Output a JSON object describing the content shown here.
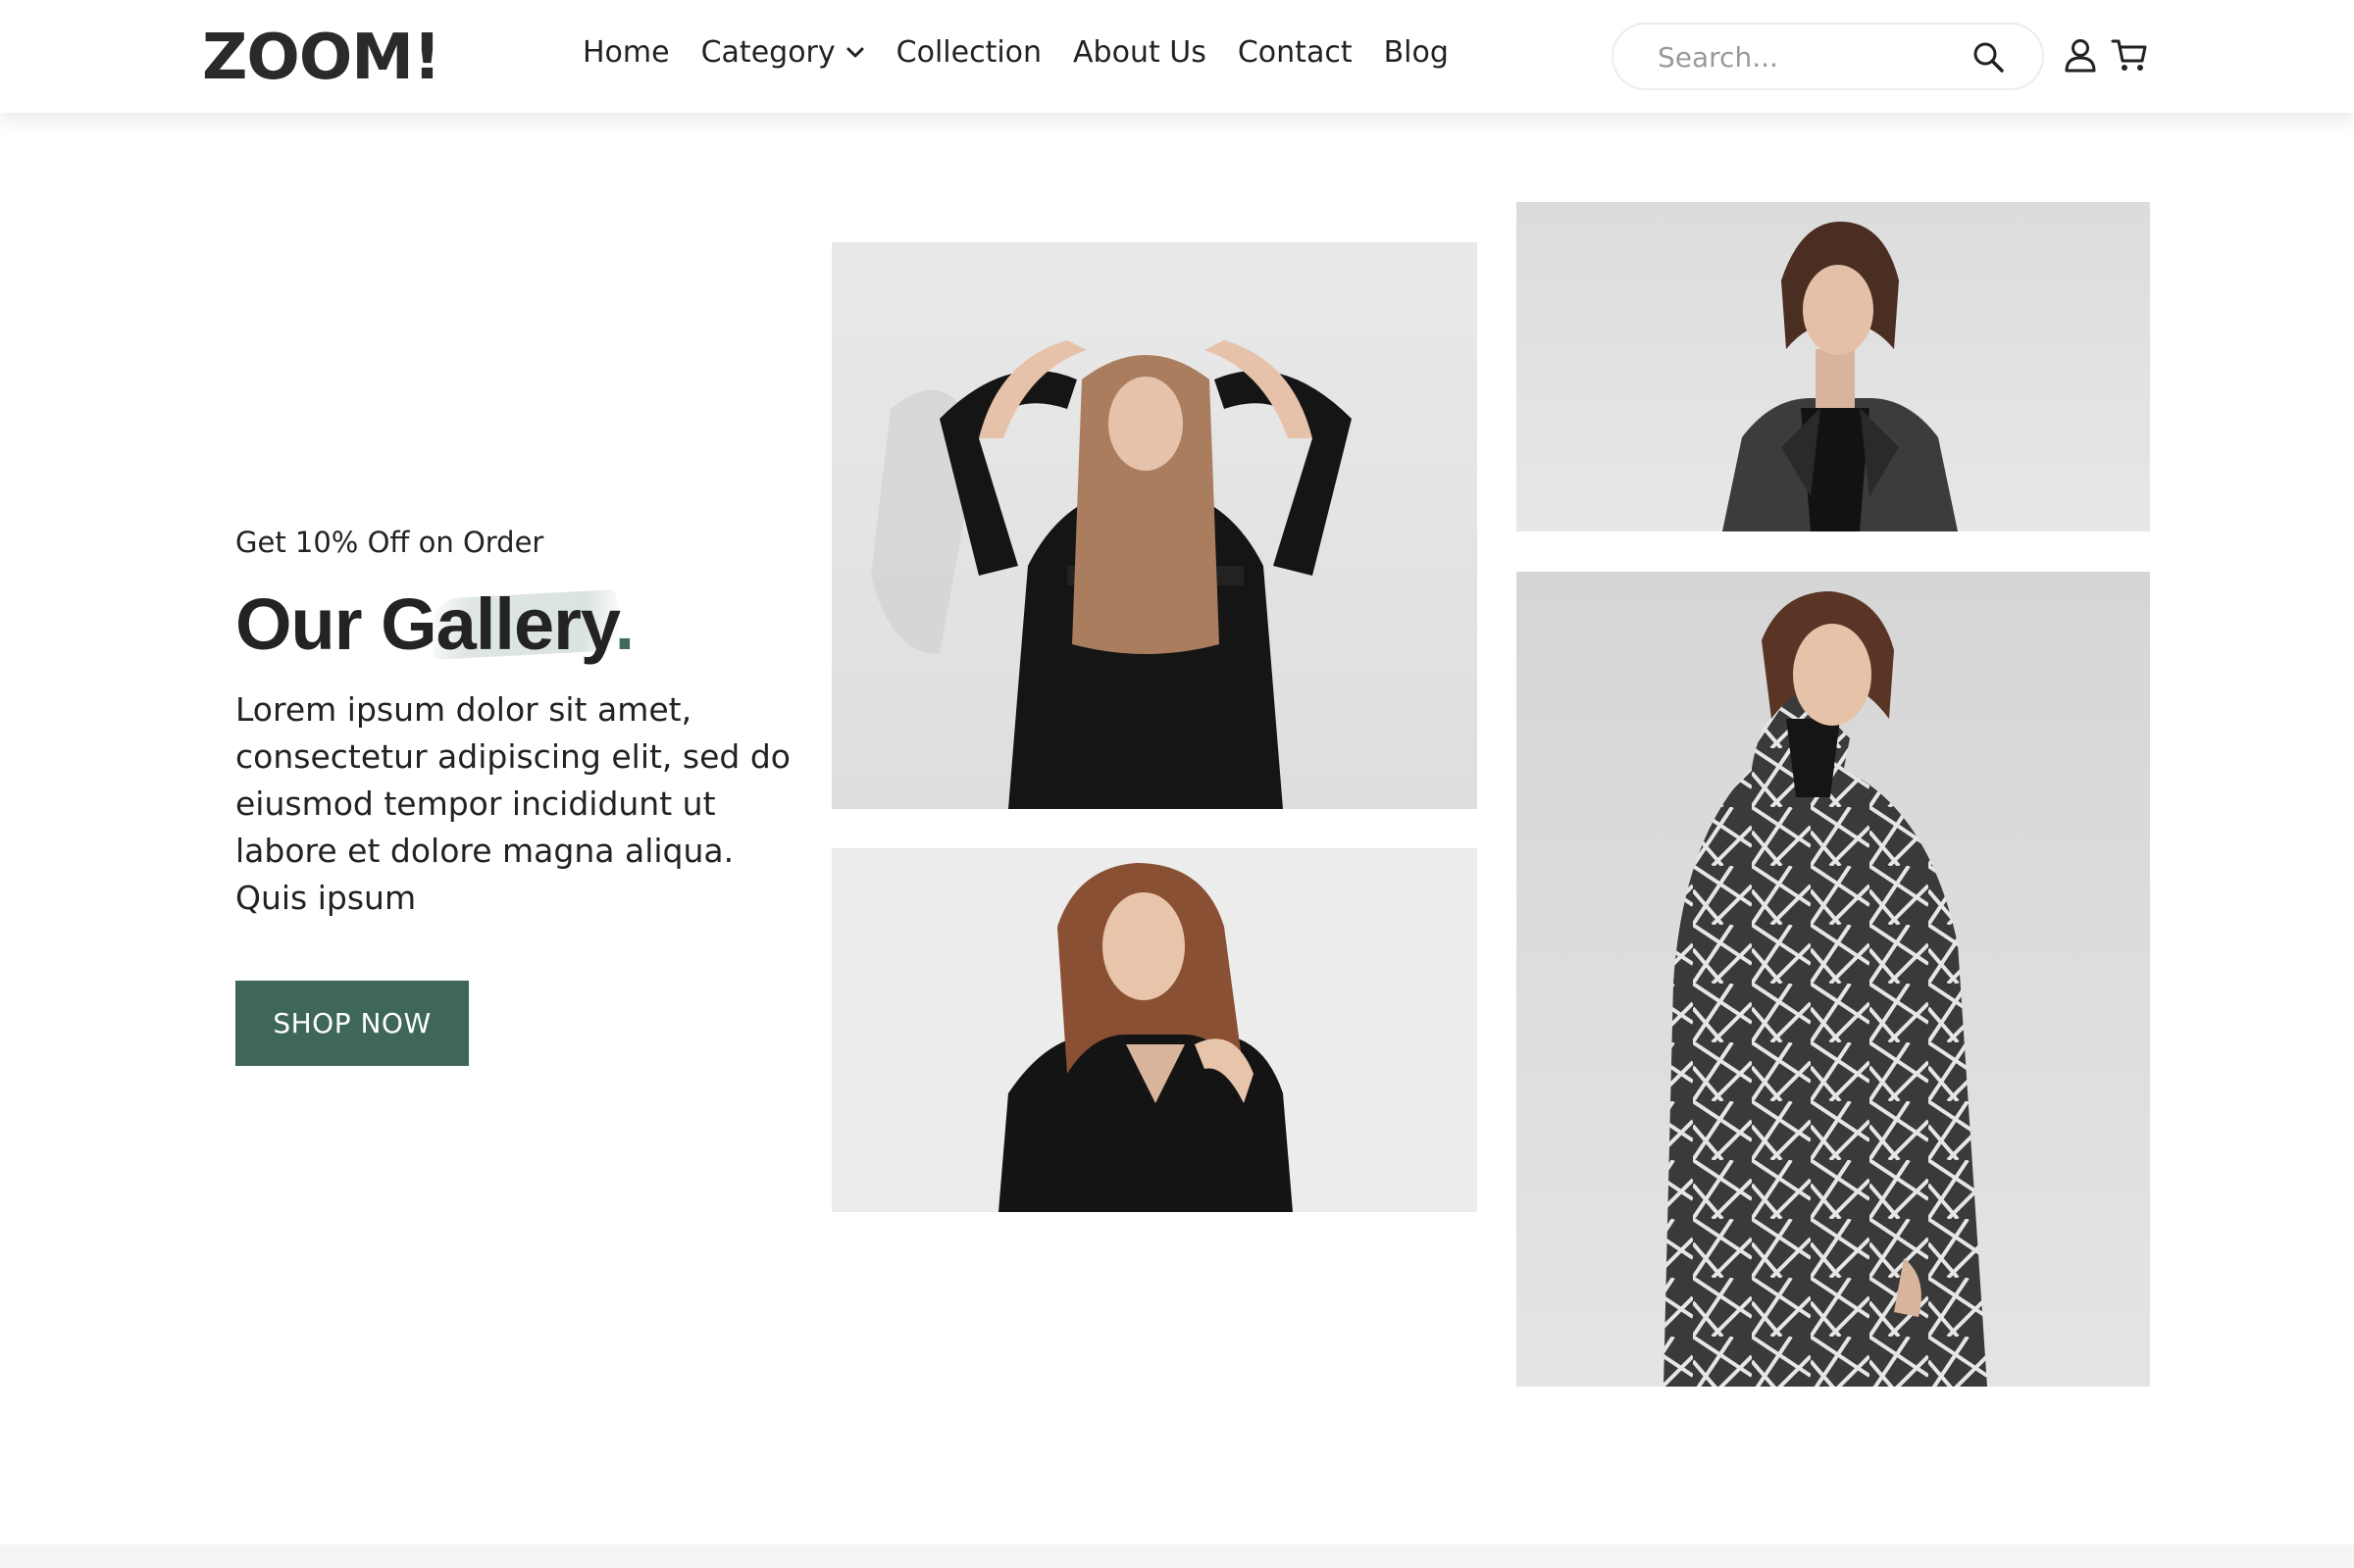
{
  "header": {
    "logo": "ZOOM!",
    "nav": [
      {
        "label": "Home"
      },
      {
        "label": "Category"
      },
      {
        "label": "Collection"
      },
      {
        "label": "About Us"
      },
      {
        "label": "Contact"
      },
      {
        "label": "Blog"
      }
    ],
    "search": {
      "placeholder": "Search..."
    },
    "icons": [
      "search-icon",
      "user-icon",
      "cart-icon",
      "chevron-down-icon"
    ]
  },
  "hero": {
    "promo": "Get 10% Off on Order",
    "heading": "Our Gallery",
    "heading_dot": ".",
    "description": "Lorem ipsum dolor sit amet, consectetur adipiscing elit, sed do eiusmod tempor incididunt ut labore et dolore magna aliqua. Quis ipsum",
    "cta": "SHOP NOW"
  },
  "colors": {
    "accent": "#3f665b",
    "text": "#222222"
  }
}
